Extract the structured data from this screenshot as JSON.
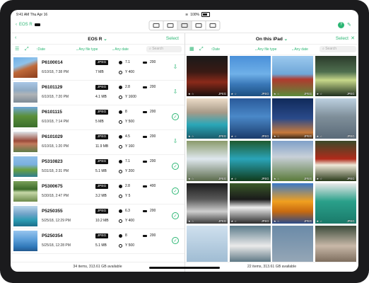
{
  "status": {
    "time": "9:41 AM",
    "date": "Thu Apr 16",
    "battery": "100%"
  },
  "app": {
    "back_label": "EOS R",
    "mode_icons": [
      "camera-icon",
      "settings-icon",
      "gallery-icon",
      "map-icon",
      "remote-icon"
    ]
  },
  "left_pane": {
    "title": "EOS R",
    "select_label": "Select",
    "filters": {
      "date": "Date",
      "file_type": "Any file type",
      "any_date": "Any date"
    },
    "search_placeholder": "Search",
    "footer": "34 items, 313.61 GB available",
    "rows": [
      {
        "name": "P6100014",
        "date": "6/10/18, 7:38 PM",
        "type": "JPEG",
        "size": "7 MB",
        "aperture": "7.1",
        "iso": "Y 400",
        "shutter": "200",
        "status": "download"
      },
      {
        "name": "P6101129",
        "date": "6/10/18, 7:20 PM",
        "type": "JPEG",
        "size": "4.1 MB",
        "aperture": "2.8",
        "iso": "Y 1600",
        "shutter": "200",
        "status": "download"
      },
      {
        "name": "P6101115",
        "date": "6/10/18, 7:14 PM",
        "type": "JPEG",
        "size": "5 MB",
        "aperture": "8",
        "iso": "Y 500",
        "shutter": "200",
        "status": "done"
      },
      {
        "name": "P6101029",
        "date": "6/10/18, 1:20 PM",
        "type": "JPEG",
        "size": "11.9 MB",
        "aperture": "4.5",
        "iso": "Y 160",
        "shutter": "200",
        "status": "download"
      },
      {
        "name": "P5310823",
        "date": "5/31/18, 2:31 PM",
        "type": "JPEG",
        "size": "5.1 MB",
        "aperture": "7.1",
        "iso": "Y 200",
        "shutter": "200",
        "status": "done"
      },
      {
        "name": "P5300675",
        "date": "5/30/18, 2:47 PM",
        "type": "JPEG",
        "size": "3.2 MB",
        "aperture": "2.8",
        "iso": "Y 5",
        "shutter": "400",
        "status": "done"
      },
      {
        "name": "P5250355",
        "date": "5/25/18, 12:29 PM",
        "type": "JPEG",
        "size": "10.2 MB",
        "aperture": "6.3",
        "iso": "Y 400",
        "shutter": "200",
        "status": "done"
      },
      {
        "name": "P5250354",
        "date": "5/25/18, 12:28 PM",
        "type": "JPEG",
        "size": "5.1 MB",
        "aperture": "8",
        "iso": "Y 500",
        "shutter": "200",
        "status": "done"
      }
    ]
  },
  "right_pane": {
    "title": "On this iPad",
    "select_label": "Select",
    "filters": {
      "date": "Date",
      "file_type": "Any file type",
      "any_date": "Any date"
    },
    "search_placeholder": "Search",
    "footer": "22 items, 313.61 GB available",
    "tiles": [
      {
        "meta": "★ ☆",
        "type": "JPEG"
      },
      {
        "meta": "★ ☆",
        "type": "JPEG"
      },
      {
        "meta": "★ ☆",
        "type": "JPEG"
      },
      {
        "meta": "★ ☆",
        "type": "JPEG"
      },
      {
        "meta": "★ ☆",
        "type": "JPEG"
      },
      {
        "meta": "★ ☆",
        "type": "JPEG"
      },
      {
        "meta": "★ ☆",
        "type": "JPEG"
      },
      {
        "meta": "★ ☆",
        "type": "JPEG"
      },
      {
        "meta": "★ ☆",
        "type": "JPEG"
      },
      {
        "meta": "★ ☆",
        "type": "JPEG"
      },
      {
        "meta": "★ ☆",
        "type": "JPEG"
      },
      {
        "meta": "★ ☆",
        "type": "JPEG"
      },
      {
        "meta": "★ ☆",
        "type": "JPEG"
      },
      {
        "meta": "★ ☆",
        "type": "JPEG"
      },
      {
        "meta": "★ ☆",
        "type": "JPEG"
      },
      {
        "meta": "★ ☆",
        "type": "JPEG"
      },
      {
        "meta": "",
        "type": ""
      },
      {
        "meta": "",
        "type": ""
      },
      {
        "meta": "",
        "type": ""
      },
      {
        "meta": "",
        "type": ""
      }
    ]
  },
  "colors": {
    "accent": "#2bb673"
  }
}
